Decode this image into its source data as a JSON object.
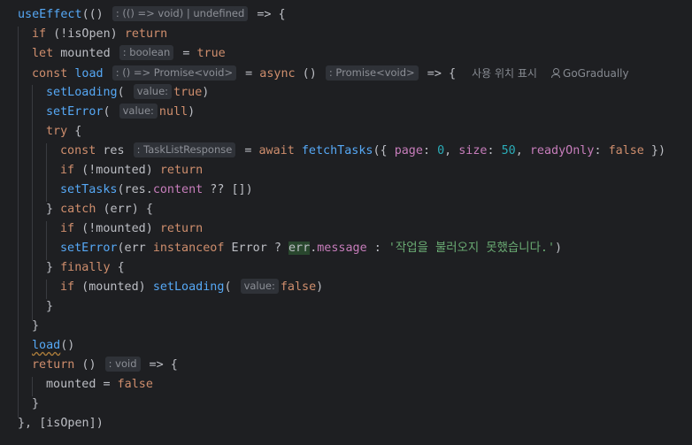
{
  "editor": {
    "codevision": {
      "usages": "사용 위치 표시",
      "author": "GoGradually"
    },
    "hints": {
      "use_effect_param": ": (() => void) | undefined",
      "mounted_type": ": boolean",
      "load_type": ": () => Promise<void>",
      "async_return": ": Promise<void>",
      "value_label": "value:",
      "res_type": ": TaskListResponse",
      "cleanup_return": ": void"
    },
    "code": {
      "use_effect": "useEffect",
      "is_open_check": "if (!isOpen) return",
      "let_mounted": "let mounted",
      "true_val": "true",
      "const_load": "const load",
      "async_kw": "async",
      "set_loading": "setLoading",
      "set_error": "setError",
      "null_val": "null",
      "try_kw": "try",
      "const_res": "const res",
      "await_kw": "await",
      "fetch_tasks": "fetchTasks",
      "page_key": "page",
      "page_val": "0",
      "size_key": "size",
      "size_val": "50",
      "ready_key": "readyOnly",
      "false_val": "false",
      "set_tasks": "setTasks",
      "content_prop": "content",
      "catch_kw": "catch",
      "message_prop": "message",
      "error_string": "'작업을 불러오지 못했습니다.'",
      "finally_kw": "finally",
      "load_call": "load",
      "return_kw": "return",
      "deps": "[isOpen]"
    }
  }
}
